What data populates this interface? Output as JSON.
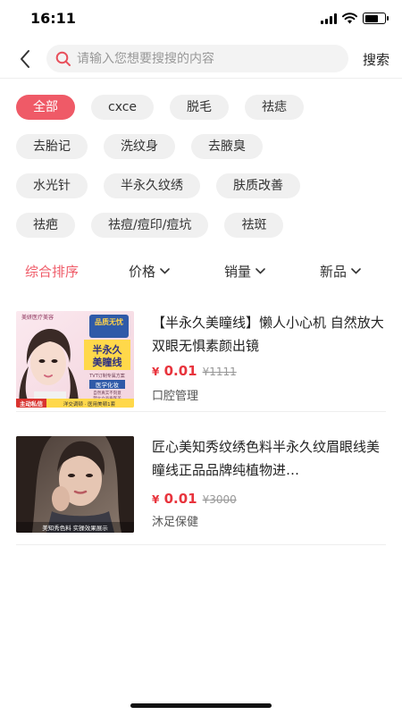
{
  "status": {
    "time": "16:11",
    "battery_level": 0.7
  },
  "search": {
    "placeholder": "请输入您想要搜搜的内容",
    "button_label": "搜索"
  },
  "tags": [
    [
      "全部",
      "cxce",
      "脱毛",
      "祛痣"
    ],
    [
      "去胎记",
      "洗纹身",
      "去腋臭"
    ],
    [
      "水光针",
      "半永久纹绣",
      "肤质改善"
    ],
    [
      "祛疤",
      "祛痘/痘印/痘坑",
      "祛斑"
    ]
  ],
  "active_tag": "全部",
  "sort": {
    "comprehensive": "综合排序",
    "price": "价格",
    "sales": "销量",
    "new": "新品"
  },
  "accent_color": "#ef5a67",
  "products": [
    {
      "title": "【半永久美瞳线】懒人小心机 自然放大双眼无惧素颜出镜",
      "currency": "¥",
      "price": "0.01",
      "old_price": "¥1111",
      "store": "口腔管理",
      "thumb": {
        "brand": "美妍医疗美容",
        "badge": "品质无忧",
        "headline_1": "半永久",
        "headline_2": "美瞳线",
        "note_1": "TVT订制专属方案",
        "note_2": "医学化妆",
        "note_3": "自然真实不刻意",
        "note_4": "塑立立品质医美",
        "cta": "主动私信",
        "footer": "洋交调顿 · 医用美顿1套"
      }
    },
    {
      "title": "匠心美知秀纹绣色料半永久纹眉眼线美瞳线正品品牌纯植物进…",
      "currency": "¥",
      "price": "0.01",
      "old_price": "¥3000",
      "store": "沐足保健",
      "thumb": {
        "caption": "美知秀色料  实操效果展示"
      }
    }
  ]
}
